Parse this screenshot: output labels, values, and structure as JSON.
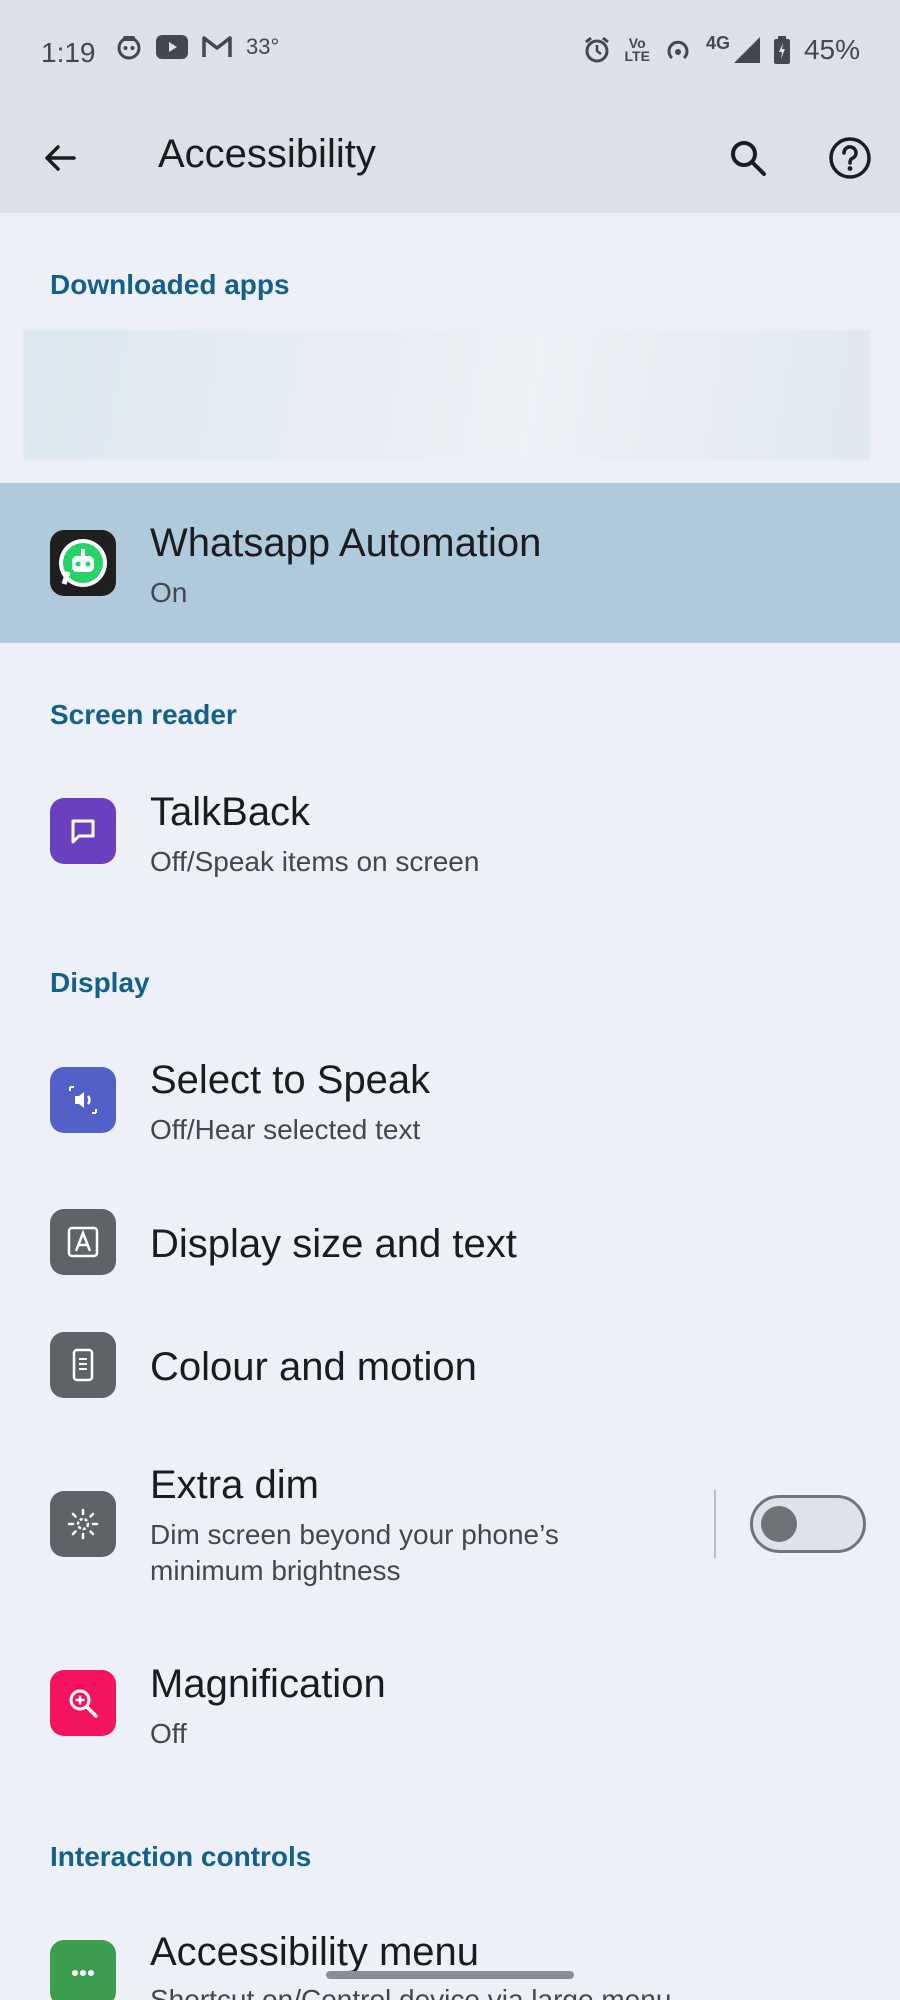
{
  "status_bar": {
    "time": "1:19",
    "temperature": "33°",
    "network": "4G",
    "volte_line1": "Vo",
    "volte_line2": "LTE",
    "battery": "45%"
  },
  "app_bar": {
    "title": "Accessibility"
  },
  "sections": {
    "downloaded_apps": "Downloaded apps",
    "screen_reader": "Screen reader",
    "display": "Display",
    "interaction_controls": "Interaction controls"
  },
  "items": {
    "whatsapp": {
      "title": "Whatsapp Automation",
      "subtitle": "On"
    },
    "talkback": {
      "title": "TalkBack",
      "subtitle": "Off/Speak items on screen"
    },
    "select_to_speak": {
      "title": "Select to Speak",
      "subtitle": "Off/Hear selected text"
    },
    "display_size": {
      "title": "Display size and text"
    },
    "colour_motion": {
      "title": "Colour and motion"
    },
    "extra_dim": {
      "title": "Extra dim",
      "subtitle_line1": "Dim screen beyond your phone’s",
      "subtitle_line2": "minimum brightness",
      "toggle_on": false
    },
    "magnification": {
      "title": "Magnification",
      "subtitle": "Off"
    },
    "accessibility_menu": {
      "title": "Accessibility menu",
      "subtitle": "Shortcut on/Control device via large menu"
    }
  },
  "colors": {
    "background": "#edf0f6",
    "topbar": "#dde1e7",
    "highlight": "#afcbdb",
    "section_header": "#13618a",
    "talkback_icon": "#6a3fc0",
    "select_to_speak_icon": "#5360c8",
    "grey_icon": "#5f6368",
    "magnification_icon": "#f4135f",
    "accessibility_menu_icon": "#3a9e4e"
  },
  "icons": {
    "back": "arrow-left-icon",
    "search": "search-icon",
    "help": "help-circle-icon"
  }
}
